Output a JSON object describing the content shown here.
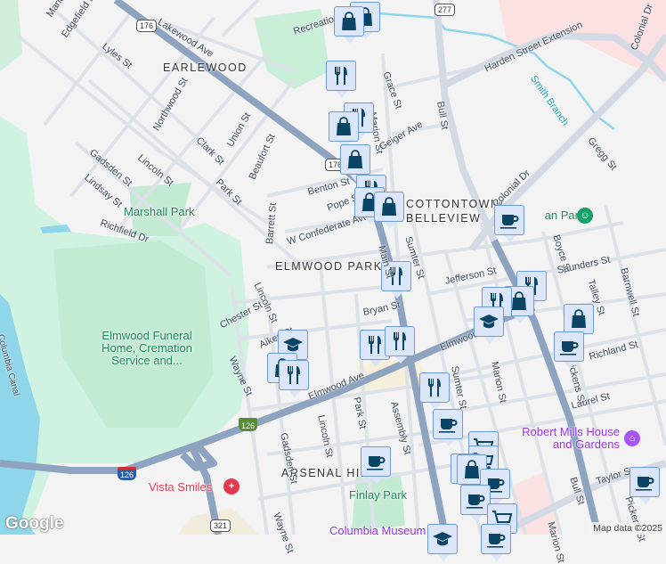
{
  "neighborhoods": {
    "earlewood": "EARLEWOOD",
    "cottontown": "COTTONTOWN/",
    "belleview": "BELLEVIEW",
    "elmwood_park": "ELMWOOD PARK",
    "arsenal_hill": "ARSENAL HILL"
  },
  "streets": {
    "marion_top": "Marion St",
    "edgefield": "Edgefield St",
    "lakewood": "Lakewood Ave",
    "lyles": "Lyles St",
    "recreation": "Recreation Dr",
    "northwood": "Northwood St",
    "union": "Union St",
    "clark": "Clark St",
    "beaufort": "Beaufort St",
    "gadsden": "Gadsden St",
    "lincoln": "Lincoln St",
    "park": "Park St",
    "lindsay": "Lindsay St",
    "richfield": "Richfield Dr",
    "barrett": "Barrett St",
    "benton": "Benton St",
    "pope": "Pope St",
    "w_confederate": "W Confederate Ave",
    "grace": "Grace St",
    "marion": "Marion St",
    "geiger": "Geiger Ave",
    "bull": "Bull St",
    "harden": "Harden Street Extension",
    "colonial_dr": "Colonial Dr",
    "colonial": "Colonial Dr",
    "gregg": "Gregg St",
    "sumter": "Sumter St",
    "boyce": "Boyce St",
    "saunders": "Saunders St",
    "barnwell": "Barnwell St",
    "jefferson": "Jefferson St",
    "talley": "Talley St",
    "bryan": "Bryan St",
    "chester": "Chester St",
    "lincoln2": "Lincoln St",
    "aiken": "Aiken St",
    "wayne": "Wayne St",
    "elmwood_ave": "Elmwood Ave",
    "main": "Main St",
    "sumter2": "Sumter St",
    "marion2": "Marion St",
    "richland": "Richland St",
    "pickens_c": "Pickens St",
    "laurel": "Laurel St",
    "assembly": "Assembly St",
    "park2": "Park St",
    "lincoln3": "Lincoln St",
    "gadsden2": "Gadsden St",
    "wayne2": "Wayne St",
    "bull2": "Bull St",
    "taylor": "Taylor St",
    "pickens": "Pickens St",
    "marion3": "Marion St",
    "sumter3": "Sumter St",
    "canal": "Columbia Canal"
  },
  "water": {
    "smith_branch": "Smith Branch"
  },
  "parks": {
    "marshall": "Marshall Park",
    "finlay": "Finlay Park",
    "logan": "Logan Park"
  },
  "pois": {
    "funeral": "Elmwood Funeral Home, Cremation Service and...",
    "vista": "Vista Smiles",
    "robert_mills": "Robert Mills House and Gardens",
    "museum": "Columbia Museum of Art"
  },
  "shields": {
    "us176a": "176",
    "us176b": "176",
    "us277": "277",
    "i126a": "126",
    "i126b": "126",
    "us321": "321"
  },
  "markers": [
    "shopping",
    "shopping",
    "dining",
    "dining",
    "shopping",
    "shopping",
    "dining",
    "shopping",
    "shopping",
    "cafe",
    "dining",
    "dining",
    "shopping",
    "dining",
    "school",
    "shopping",
    "cafe",
    "school",
    "shopping",
    "dining",
    "dining",
    "dining",
    "dining",
    "cafe",
    "cart",
    "cart",
    "shopping",
    "shopping",
    "cafe",
    "cafe",
    "cart",
    "cafe",
    "cafe",
    "school",
    "cafe"
  ],
  "footer": {
    "logo": "Google",
    "attribution": "Map data ©2025"
  },
  "colors": {
    "highway": "#8ea3bf",
    "road": "#d7dde5",
    "park": "#c9efd8",
    "water": "#8fd6ea",
    "marker_bg": "#dbe6f9",
    "marker_border": "#6e9be0",
    "icon": "#0b4566"
  }
}
